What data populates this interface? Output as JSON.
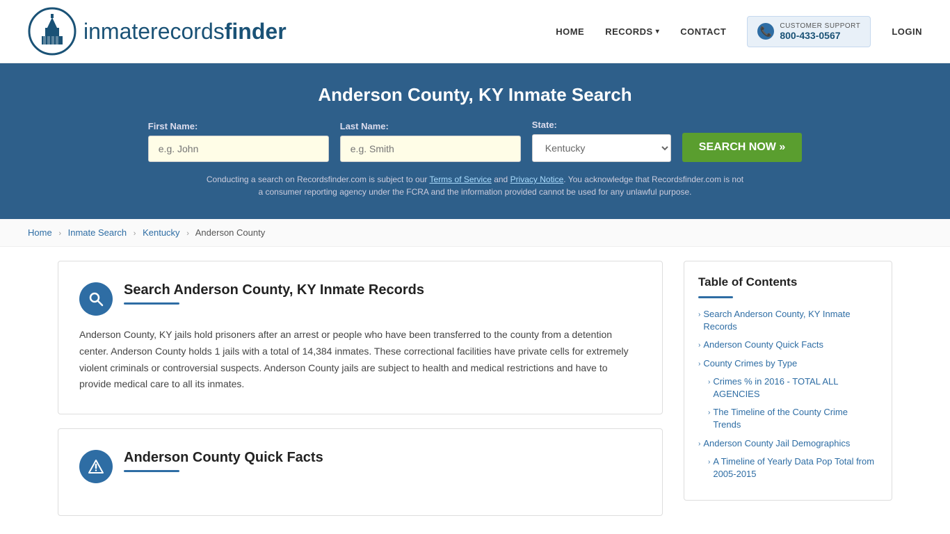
{
  "header": {
    "logo_text_normal": "inmaterecords",
    "logo_text_bold": "finder",
    "nav": {
      "home": "HOME",
      "records": "RECORDS",
      "contact": "CONTACT",
      "login": "LOGIN"
    },
    "support": {
      "label": "CUSTOMER SUPPORT",
      "number": "800-433-0567"
    }
  },
  "hero": {
    "title": "Anderson County, KY Inmate Search",
    "first_name_label": "First Name:",
    "first_name_placeholder": "e.g. John",
    "last_name_label": "Last Name:",
    "last_name_placeholder": "e.g. Smith",
    "state_label": "State:",
    "state_value": "Kentucky",
    "search_button": "SEARCH NOW »",
    "disclaimer": "Conducting a search on Recordsfinder.com is subject to our Terms of Service and Privacy Notice. You acknowledge that Recordsfinder.com is not a consumer reporting agency under the FCRA and the information provided cannot be used for any unlawful purpose.",
    "tos_link": "Terms of Service",
    "privacy_link": "Privacy Notice"
  },
  "breadcrumb": {
    "home": "Home",
    "inmate_search": "Inmate Search",
    "state": "Kentucky",
    "county": "Anderson County"
  },
  "main": {
    "section1": {
      "title": "Search Anderson County, KY Inmate Records",
      "body": "Anderson County, KY jails hold prisoners after an arrest or people who have been transferred to the county from a detention center. Anderson County holds 1 jails with a total of 14,384 inmates. These correctional facilities have private cells for extremely violent criminals or controversial suspects. Anderson County jails are subject to health and medical restrictions and have to provide medical care to all its inmates."
    },
    "section2": {
      "title": "Anderson County Quick Facts"
    }
  },
  "toc": {
    "title": "Table of Contents",
    "items": [
      {
        "label": "Search Anderson County, KY Inmate Records",
        "sub": false
      },
      {
        "label": "Anderson County Quick Facts",
        "sub": false
      },
      {
        "label": "County Crimes by Type",
        "sub": false
      },
      {
        "label": "Crimes % in 2016 - TOTAL ALL AGENCIES",
        "sub": true
      },
      {
        "label": "The Timeline of the County Crime Trends",
        "sub": true
      },
      {
        "label": "Anderson County Jail Demographics",
        "sub": false
      },
      {
        "label": "A Timeline of Yearly Data Pop Total from 2005-2015",
        "sub": true
      }
    ]
  },
  "icons": {
    "search": "🔍",
    "alert": "⚠",
    "chevron_right": "›",
    "chevron_down": "▾",
    "headset": "🎧"
  }
}
